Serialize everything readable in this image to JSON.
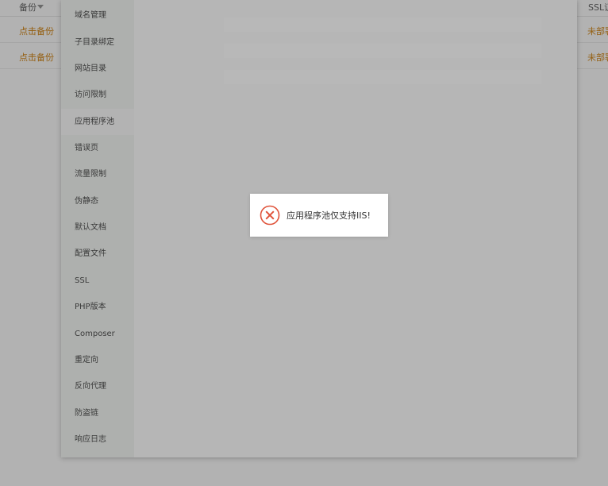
{
  "table": {
    "header": {
      "backup": "备份",
      "ssl": "SSL证"
    },
    "rows": [
      {
        "backup": "点击备份",
        "ssl": "未部署"
      },
      {
        "backup": "点击备份",
        "ssl": "未部署"
      }
    ]
  },
  "sidebar": {
    "items": [
      {
        "label": "域名管理"
      },
      {
        "label": "子目录绑定"
      },
      {
        "label": "网站目录"
      },
      {
        "label": "访问限制"
      },
      {
        "label": "应用程序池",
        "active": true
      },
      {
        "label": "错误页"
      },
      {
        "label": "流量限制"
      },
      {
        "label": "伪静态"
      },
      {
        "label": "默认文档"
      },
      {
        "label": "配置文件"
      },
      {
        "label": "SSL"
      },
      {
        "label": "PHP版本"
      },
      {
        "label": "Composer"
      },
      {
        "label": "重定向"
      },
      {
        "label": "反向代理"
      },
      {
        "label": "防盗链"
      },
      {
        "label": "响应日志"
      }
    ]
  },
  "toast": {
    "icon": "error-circle-icon",
    "message": "应用程序池仅支持IIS!",
    "icon_color": "#e0533a"
  },
  "colors": {
    "link_orange": "#d68a1c",
    "overlay": "rgba(0,0,0,0.30)"
  }
}
